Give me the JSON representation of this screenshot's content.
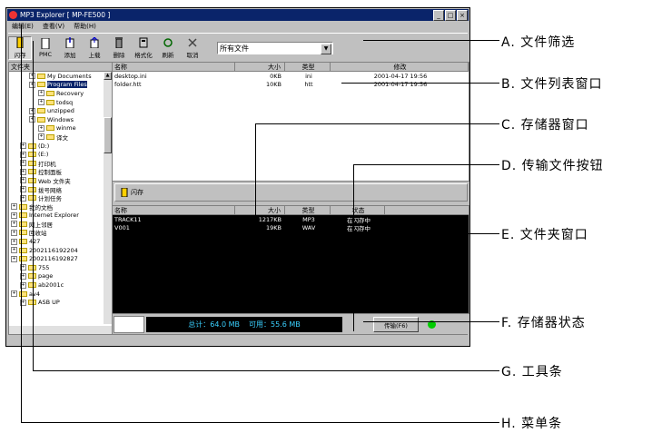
{
  "window": {
    "title": "MP3 Explorer  [ MP-FE500 ]",
    "controls": [
      "_",
      "□",
      "×"
    ]
  },
  "menu": [
    "编辑(E)",
    "查看(V)",
    "帮助(H)"
  ],
  "toolbar": {
    "buttons": [
      {
        "label": "闪存",
        "icon": "flash-icon"
      },
      {
        "label": "PMC",
        "icon": "pc-icon"
      },
      {
        "label": "添加",
        "icon": "add-icon"
      },
      {
        "label": "上载",
        "icon": "upload-icon"
      },
      {
        "label": "删除",
        "icon": "delete-icon"
      },
      {
        "label": "格式化",
        "icon": "format-icon"
      },
      {
        "label": "刷新",
        "icon": "refresh-icon"
      },
      {
        "label": "取消",
        "icon": "cancel-icon"
      }
    ],
    "filter_value": "所有文件"
  },
  "folder_pane": {
    "header": "文件夹",
    "nodes": [
      {
        "label": "My Documents",
        "indent": 2
      },
      {
        "label": "Program Files",
        "indent": 2,
        "selected": true
      },
      {
        "label": "Recovery",
        "indent": 3
      },
      {
        "label": "todsq",
        "indent": 3
      },
      {
        "label": "unzipped",
        "indent": 2
      },
      {
        "label": "Windows",
        "indent": 2
      },
      {
        "label": "winme",
        "indent": 3
      },
      {
        "label": "译文",
        "indent": 3
      },
      {
        "label": "(D:)",
        "indent": 1
      },
      {
        "label": "(E:)",
        "indent": 1
      },
      {
        "label": "打印机",
        "indent": 1
      },
      {
        "label": "控制面板",
        "indent": 1
      },
      {
        "label": "Web 文件夹",
        "indent": 1
      },
      {
        "label": "拨号网络",
        "indent": 1
      },
      {
        "label": "计划任务",
        "indent": 1
      },
      {
        "label": "我的文档",
        "indent": 0
      },
      {
        "label": "Internet Explorer",
        "indent": 0
      },
      {
        "label": "网上邻居",
        "indent": 0
      },
      {
        "label": "回收站",
        "indent": 0
      },
      {
        "label": "427",
        "indent": 0
      },
      {
        "label": "2002116192204",
        "indent": 0
      },
      {
        "label": "2002116192827",
        "indent": 0
      },
      {
        "label": "755",
        "indent": 1
      },
      {
        "label": "page",
        "indent": 1
      },
      {
        "label": "ab2001c",
        "indent": 1
      },
      {
        "label": "av4",
        "indent": 0
      },
      {
        "label": "ASB UP",
        "indent": 1
      }
    ]
  },
  "file_list": {
    "columns": [
      "名称",
      "大小",
      "类型",
      "修改"
    ],
    "rows": [
      {
        "name": "desktop.ini",
        "size": "0KB",
        "type": "ini",
        "modified": "2001-04-17 19:56"
      },
      {
        "name": "folder.htt",
        "size": "10KB",
        "type": "htt",
        "modified": "2001-04-17 19:56"
      }
    ]
  },
  "storage_bar": {
    "label": "闪存"
  },
  "storage_list": {
    "columns": [
      "名称",
      "大小",
      "类型",
      "状态"
    ],
    "rows": [
      {
        "name": "TRACK11",
        "size": "1217KB",
        "type": "MP3",
        "status": "在闪存中"
      },
      {
        "name": "V001",
        "size": "19KB",
        "type": "WAV",
        "status": "在闪存中"
      }
    ]
  },
  "status": {
    "total": "总计：64.0 MB",
    "available": "可用：55.6 MB",
    "transfer_button": "传输(F6)",
    "led_color": "#00cc00"
  },
  "callouts": [
    "A. 文件筛选",
    "B. 文件列表窗口",
    "C. 存储器窗口",
    "D. 传输文件按钮",
    "E. 文件夹窗口",
    "F. 存储器状态",
    "G. 工具条",
    "H. 菜单条"
  ]
}
